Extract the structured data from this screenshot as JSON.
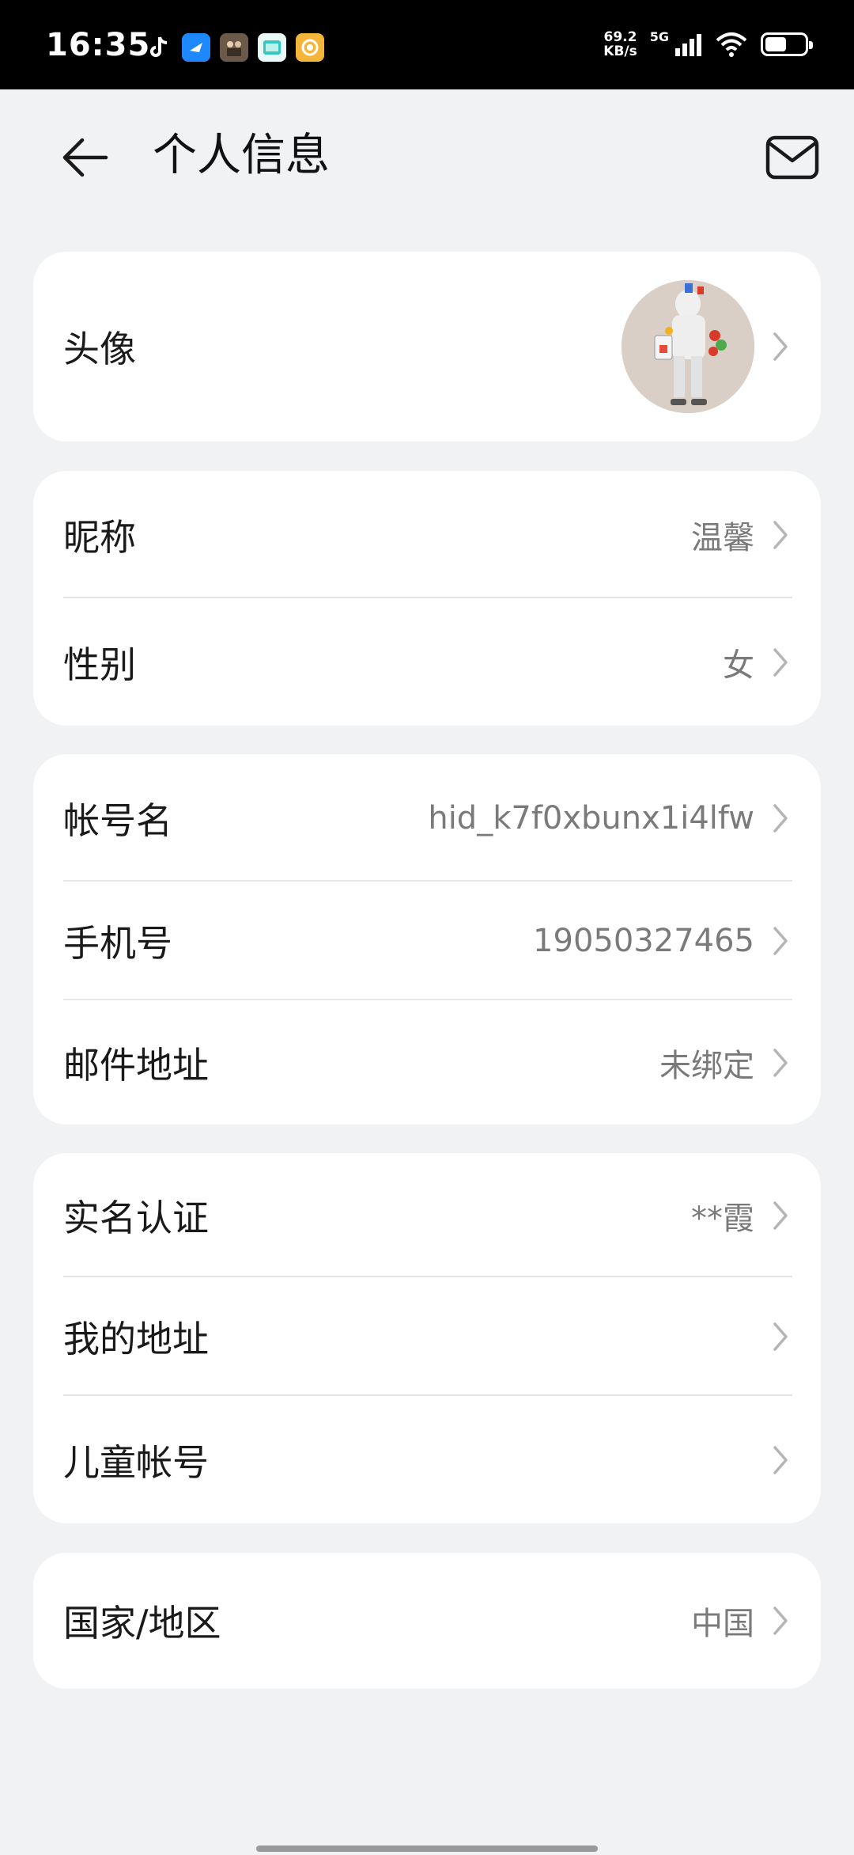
{
  "status_bar": {
    "time": "16:35",
    "net_speed_value": "69.2",
    "net_speed_unit": "KB/s",
    "network_type": "5G",
    "battery_level": 0.6,
    "app_icons": [
      "tiktok-icon",
      "blue-app-icon",
      "game-app-icon",
      "teal-app-icon",
      "orange-app-icon"
    ]
  },
  "header": {
    "title": "个人信息"
  },
  "avatar_card": {
    "label": "头像"
  },
  "profile_card": {
    "rows": [
      {
        "label": "昵称",
        "value": "温馨"
      },
      {
        "label": "性别",
        "value": "女"
      }
    ]
  },
  "account_card": {
    "rows": [
      {
        "label": "帐号名",
        "value": "hid_k7f0xbunx1i4lfw"
      },
      {
        "label": "手机号",
        "value": "19050327465"
      },
      {
        "label": "邮件地址",
        "value": "未绑定"
      }
    ]
  },
  "identity_card": {
    "rows": [
      {
        "label": "实名认证",
        "value": "**霞"
      },
      {
        "label": "我的地址",
        "value": ""
      },
      {
        "label": "儿童帐号",
        "value": ""
      }
    ]
  },
  "region_card": {
    "rows": [
      {
        "label": "国家/地区",
        "value": "中国"
      }
    ]
  },
  "colors": {
    "background": "#f1f2f4",
    "card": "#ffffff",
    "value_text": "#7a7a7a",
    "chevron": "#b5b5b5"
  }
}
